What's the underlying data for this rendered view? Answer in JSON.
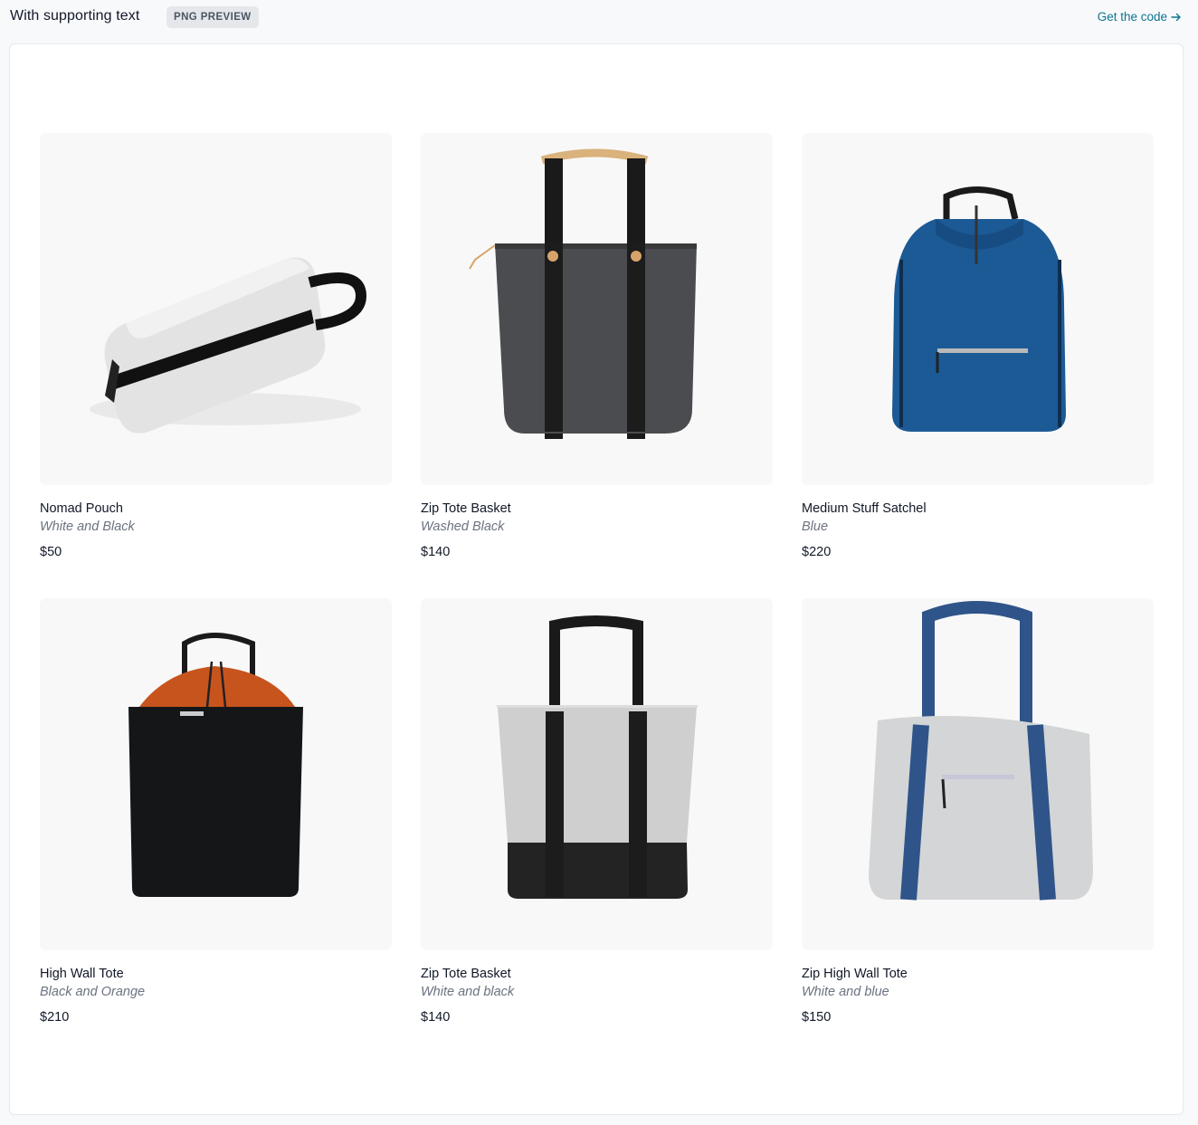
{
  "header": {
    "title": "With supporting text",
    "badge": "PNG PREVIEW",
    "code_link": "Get the code",
    "code_link_icon": "arrow-right-icon",
    "accent": "#0e7490"
  },
  "products": [
    {
      "name": "Nomad Pouch",
      "color": "White and Black",
      "price": "$50",
      "image": "nomad-pouch-image"
    },
    {
      "name": "Zip Tote Basket",
      "color": "Washed Black",
      "price": "$140",
      "image": "zip-tote-basket-washed-black-image"
    },
    {
      "name": "Medium Stuff Satchel",
      "color": "Blue",
      "price": "$220",
      "image": "medium-stuff-satchel-image"
    },
    {
      "name": "High Wall Tote",
      "color": "Black and Orange",
      "price": "$210",
      "image": "high-wall-tote-image"
    },
    {
      "name": "Zip Tote Basket",
      "color": "White and black",
      "price": "$140",
      "image": "zip-tote-basket-white-black-image"
    },
    {
      "name": "Zip High Wall Tote",
      "color": "White and blue",
      "price": "$150",
      "image": "zip-high-wall-tote-image"
    }
  ]
}
